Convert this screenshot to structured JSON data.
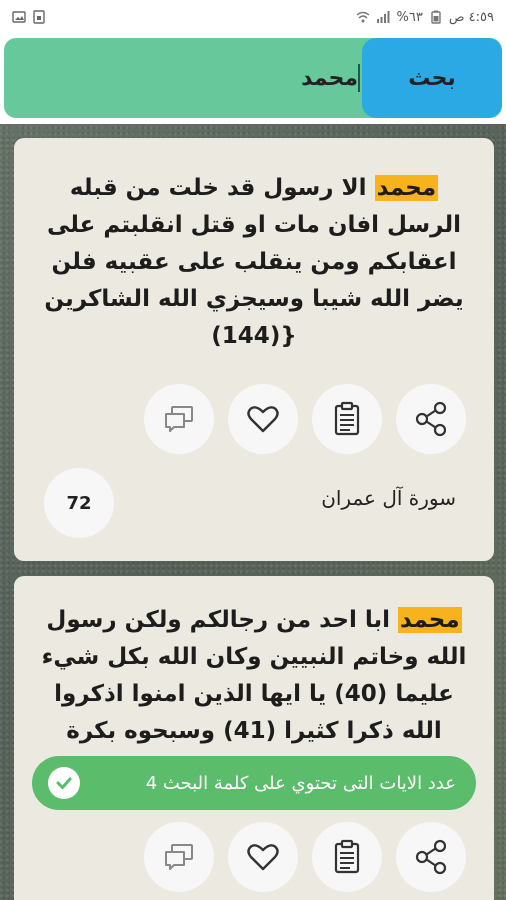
{
  "status_bar": {
    "time": "٤:٥٩ ص",
    "battery": "%٦٣"
  },
  "search": {
    "value": "محمد",
    "button_label": "بحث"
  },
  "cards": [
    {
      "highlight": "محمد",
      "verse_rest": " الا رسول قد خلت من قبله الرسل افان مات او قتل انقلبتم على اعقابكم ومن ينقلب على عقبيه فلن يضر الله شيبا وسيجزي الله الشاكرين {(144)",
      "surah": "سورة آل عمران",
      "number": "72"
    },
    {
      "highlight": "محمد",
      "verse_rest": " ابا احد من رجالكم ولكن رسول الله وخاتم النبيين وكان الله بكل شيء عليما (40) يا ايها الذين امنوا اذكروا الله ذكرا كثيرا (41) وسبحوه بكرة"
    }
  ],
  "snackbar": {
    "text": "عدد الايات التى تحتوي على كلمة البحث 4"
  },
  "icons": {
    "share": "share-icon",
    "copy": "clipboard-icon",
    "favorite": "heart-icon",
    "comment": "comments-icon"
  },
  "colors": {
    "search_bar": "#67c99b",
    "search_button": "#2aa9e4",
    "highlight": "#f7b21c",
    "card": "#eceae0",
    "snackbar": "#5bbd6c"
  }
}
